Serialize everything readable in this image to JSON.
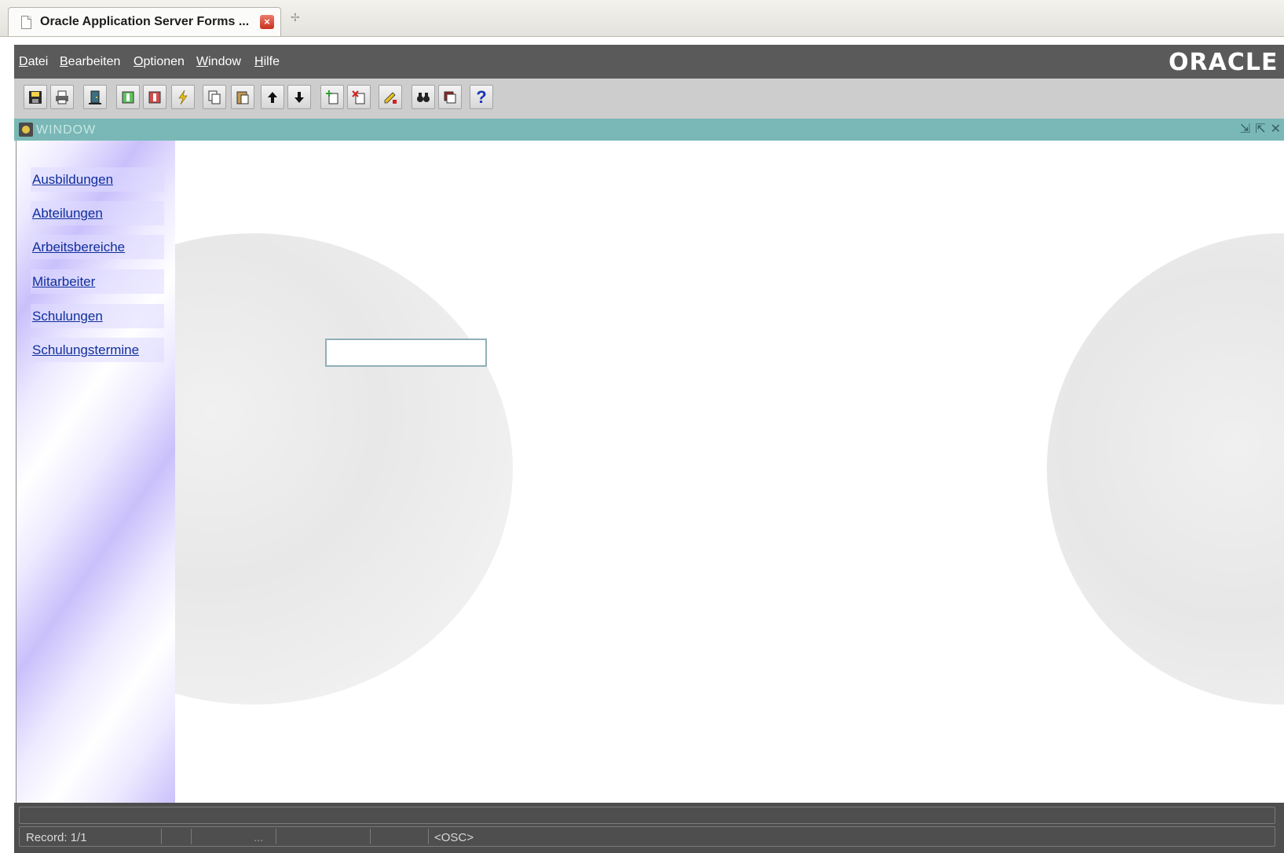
{
  "browser": {
    "tab_title": "Oracle Application Server Forms ..."
  },
  "menubar": {
    "items": [
      "Datei",
      "Bearbeiten",
      "Optionen",
      "Window",
      "Hilfe"
    ],
    "logo": "ORACLE"
  },
  "toolbar": {
    "buttons": [
      {
        "icon": "save-icon"
      },
      {
        "icon": "print-icon"
      },
      {
        "icon": "exit-icon"
      },
      {
        "icon": "enter-query-icon"
      },
      {
        "icon": "execute-query-icon"
      },
      {
        "icon": "lightning-icon"
      },
      {
        "icon": "copy-icon"
      },
      {
        "icon": "paste-icon"
      },
      {
        "icon": "arrow-up-icon"
      },
      {
        "icon": "arrow-down-icon"
      },
      {
        "icon": "insert-record-icon"
      },
      {
        "icon": "delete-record-icon"
      },
      {
        "icon": "edit-icon"
      },
      {
        "icon": "binoculars-icon"
      },
      {
        "icon": "lov-icon"
      },
      {
        "icon": "help-icon"
      }
    ]
  },
  "window": {
    "title": "WINDOW"
  },
  "sidebar": {
    "items": [
      {
        "label": "Ausbildungen"
      },
      {
        "label": "Abteilungen"
      },
      {
        "label": "Arbeitsbereiche"
      },
      {
        "label": "Mitarbeiter"
      },
      {
        "label": "Schulungen"
      },
      {
        "label": "Schulungstermine"
      }
    ]
  },
  "main": {
    "input_value": ""
  },
  "status": {
    "record": "Record: 1/1",
    "ellipsis": "...",
    "mode": "<OSC>"
  },
  "colors": {
    "menubar": "#5a5a5a",
    "window_title": "#79b8b6",
    "link": "#0f2f9b",
    "status_bar": "#4e4e4e"
  }
}
